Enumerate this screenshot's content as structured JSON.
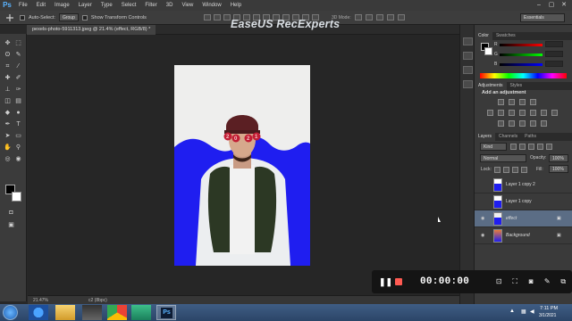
{
  "app": {
    "logo": "Ps"
  },
  "menu": [
    "File",
    "Edit",
    "Image",
    "Layer",
    "Type",
    "Select",
    "Filter",
    "3D",
    "View",
    "Window",
    "Help"
  ],
  "window_controls": [
    "–",
    "▢",
    "✕"
  ],
  "options": {
    "auto_select_label": "Auto-Select:",
    "auto_select_value": "Group",
    "transform_label": "Show Transform Controls",
    "mode_3d": "3D Mode:",
    "workspace": "Essentials"
  },
  "watermark": "EaseUS RecExperts",
  "document": {
    "tab_title": "pexels-photo-5911313.jpeg @ 21.4% (effect, RGB/8) *",
    "zoom": "21.47%",
    "info": "c2 (8bpc)"
  },
  "panels": {
    "color_tabs": [
      "Color",
      "Swatches"
    ],
    "slider_labels": [
      "R",
      "G",
      "B"
    ],
    "adjust_tabs": [
      "Adjustments",
      "Styles"
    ],
    "adjust_title": "Add an adjustment",
    "layers_tabs": [
      "Layers",
      "Channels",
      "Paths"
    ],
    "kind_label": "Kind",
    "blend_mode": "Normal",
    "opacity_label": "Opacity:",
    "opacity_value": "100%",
    "lock_label": "Lock:",
    "fill_label": "Fill:",
    "fill_value": "100%",
    "layers": [
      {
        "name": "Layer 1 copy 2",
        "visible": false,
        "italic": false,
        "selected": false
      },
      {
        "name": "Layer 1 copy",
        "visible": false,
        "italic": false,
        "selected": false
      },
      {
        "name": "effect",
        "visible": true,
        "italic": true,
        "selected": true
      },
      {
        "name": "Background",
        "visible": true,
        "italic": true,
        "selected": false
      }
    ]
  },
  "recorder": {
    "timer": "00:00:00"
  },
  "taskbar": {
    "time": "7:11 PM",
    "date": "3/1/2021"
  },
  "colors": {
    "accent_blue": "#1f1ef0",
    "record_red": "#ff5a52",
    "ps_blue": "#5ab3ff"
  }
}
